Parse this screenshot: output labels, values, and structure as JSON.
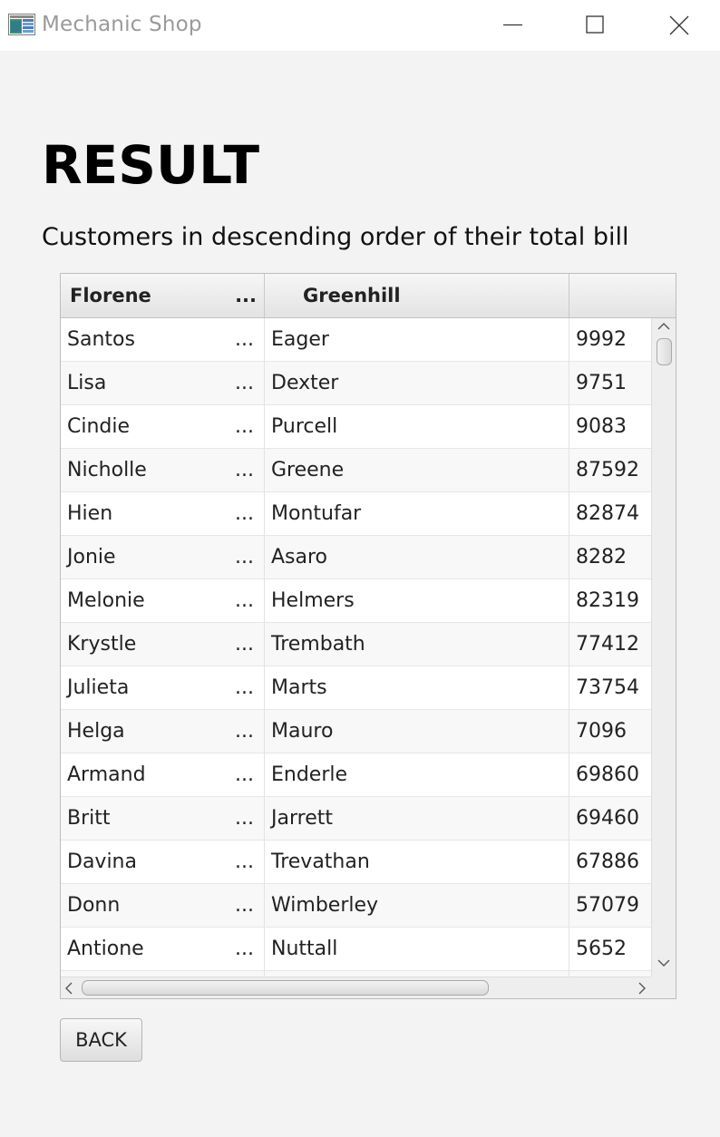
{
  "window": {
    "title": "Mechanic Shop",
    "icons": [
      "app-icon",
      "minimize-icon",
      "maximize-icon",
      "close-icon"
    ]
  },
  "heading": "RESULT",
  "subtitle": "Customers in descending order of their total bill",
  "table": {
    "columns": [
      {
        "label": "Florene",
        "ellipsis": "..."
      },
      {
        "label": "Greenhill"
      },
      {
        "label": ""
      }
    ],
    "rows": [
      {
        "first": "Santos",
        "last": "Eager",
        "total": "9992"
      },
      {
        "first": "Lisa",
        "last": "Dexter",
        "total": "9751"
      },
      {
        "first": "Cindie",
        "last": "Purcell",
        "total": "9083"
      },
      {
        "first": "Nicholle",
        "last": "Greene",
        "total": "87592"
      },
      {
        "first": "Hien",
        "last": "Montufar",
        "total": "82874"
      },
      {
        "first": "Jonie",
        "last": "Asaro",
        "total": "8282"
      },
      {
        "first": "Melonie",
        "last": "Helmers",
        "total": "82319"
      },
      {
        "first": "Krystle",
        "last": "Trembath",
        "total": "77412"
      },
      {
        "first": "Julieta",
        "last": "Marts",
        "total": "73754"
      },
      {
        "first": "Helga",
        "last": "Mauro",
        "total": "7096"
      },
      {
        "first": "Armand",
        "last": "Enderle",
        "total": "69860"
      },
      {
        "first": "Britt",
        "last": "Jarrett",
        "total": "69460"
      },
      {
        "first": "Davina",
        "last": "Trevathan",
        "total": "67886"
      },
      {
        "first": "Donn",
        "last": "Wimberley",
        "total": "57079"
      },
      {
        "first": "Antione",
        "last": "Nuttall",
        "total": "5652"
      }
    ],
    "cell_ellipsis": "..."
  },
  "back_button": "BACK"
}
